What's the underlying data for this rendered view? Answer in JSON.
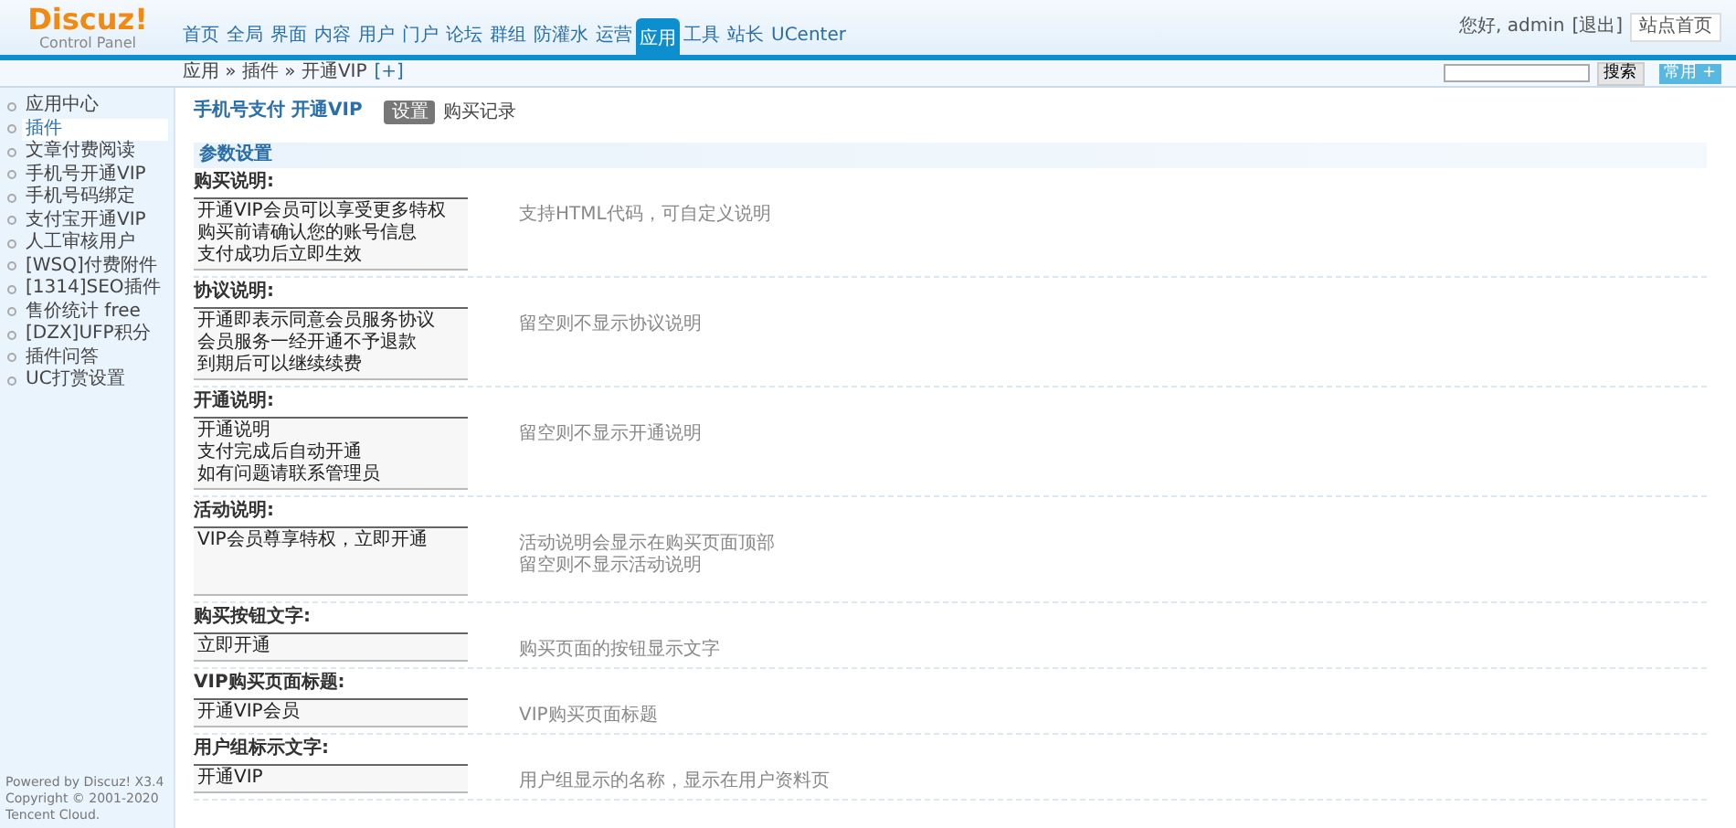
{
  "header": {
    "logo": "Discuz!",
    "logo_sub": "Control Panel",
    "nav": [
      {
        "label": "首页",
        "selected": false
      },
      {
        "label": "全局",
        "selected": false
      },
      {
        "label": "界面",
        "selected": false
      },
      {
        "label": "内容",
        "selected": false
      },
      {
        "label": "用户",
        "selected": false
      },
      {
        "label": "门户",
        "selected": false
      },
      {
        "label": "论坛",
        "selected": false
      },
      {
        "label": "群组",
        "selected": false
      },
      {
        "label": "防灌水",
        "selected": false
      },
      {
        "label": "运营",
        "selected": false
      },
      {
        "label": "应用",
        "selected": true
      },
      {
        "label": "工具",
        "selected": false
      },
      {
        "label": "站长",
        "selected": false
      },
      {
        "label": "UCenter",
        "selected": false
      }
    ],
    "greeting": "您好, admin",
    "logout": "[退出]",
    "site_home": "站点首页"
  },
  "subbar": {
    "breadcrumb": "应用 » 插件 » 开通VIP",
    "add": "[+]",
    "search_button": "搜索",
    "quick_button": "常用 +"
  },
  "sidebar": {
    "items": [
      {
        "label": "应用中心",
        "selected": false
      },
      {
        "label": "插件",
        "selected": true
      },
      {
        "label": "文章付费阅读",
        "selected": false
      },
      {
        "label": "手机号开通VIP",
        "selected": false
      },
      {
        "label": "手机号码绑定",
        "selected": false
      },
      {
        "label": "支付宝开通VIP",
        "selected": false
      },
      {
        "label": "人工审核用户",
        "selected": false
      },
      {
        "label": "[WSQ]付费附件",
        "selected": false
      },
      {
        "label": "[1314]SEO插件",
        "selected": false
      },
      {
        "label": "售价统计 free",
        "selected": false
      },
      {
        "label": "[DZX]UFP积分",
        "selected": false
      },
      {
        "label": "插件问答",
        "selected": false
      },
      {
        "label": "UC打赏设置",
        "selected": false
      }
    ],
    "footer": [
      "Powered by Discuz! X3.4",
      "Copyright © 2001-2020",
      "Tencent Cloud."
    ]
  },
  "main": {
    "title": "手机号支付 开通VIP",
    "tabs": [
      {
        "label": "设置",
        "selected": true
      },
      {
        "label": "购买记录",
        "selected": false
      }
    ],
    "section": "参数设置",
    "fields": [
      {
        "kind": "textarea",
        "label": "购买说明:",
        "value": [
          "开通VIP会员可以享受更多特权",
          "购买前请确认您的账号信息",
          "支付成功后立即生效"
        ],
        "comment": [
          "支持HTML代码，可自定义说明"
        ]
      },
      {
        "kind": "textarea",
        "label": "协议说明:",
        "value": [
          "开通即表示同意会员服务协议",
          "会员服务一经开通不予退款",
          "到期后可以继续续费"
        ],
        "comment": [
          "留空则不显示协议说明"
        ]
      },
      {
        "kind": "textarea",
        "label": "开通说明:",
        "value": [
          "开通说明",
          "支付完成后自动开通",
          "如有问题请联系管理员"
        ],
        "comment": [
          "留空则不显示开通说明"
        ]
      },
      {
        "kind": "textarea",
        "label": "活动说明:",
        "value": [
          "VIP会员尊享特权，立即开通"
        ],
        "comment": [
          "活动说明会显示在购买页面顶部",
          "留空则不显示活动说明"
        ]
      },
      {
        "kind": "input",
        "label": "购买按钮文字:",
        "value": [
          "立即开通"
        ],
        "comment": [
          "购买页面的按钮显示文字"
        ]
      },
      {
        "kind": "input",
        "label": "VIP购买页面标题:",
        "value": [
          "开通VIP会员"
        ],
        "comment": [
          "VIP购买页面标题"
        ]
      },
      {
        "kind": "input",
        "label": "用户组标示文字:",
        "value": [
          "开通VIP"
        ],
        "comment": [
          "用户组显示的名称，显示在用户资料页"
        ]
      }
    ]
  }
}
